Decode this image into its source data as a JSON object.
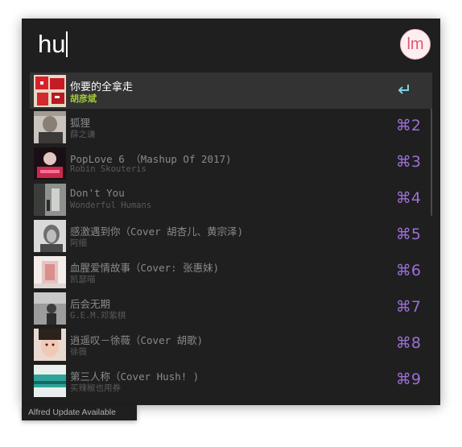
{
  "search": {
    "query": "hu"
  },
  "avatar": {
    "initials": "lm",
    "color": "#e0576f"
  },
  "accent_color": "#9b6fd6",
  "selected_subtitle_color": "#a3c93a",
  "results": [
    {
      "title": "你要的全拿走",
      "subtitle": "胡彦斌",
      "shortcut": "",
      "selected": true,
      "action_icon": "return-icon"
    },
    {
      "title": "狐狸",
      "subtitle": "薛之谦",
      "shortcut": "⌘2"
    },
    {
      "title": "PopLove 6 （Mashup Of 2017)",
      "subtitle": "Robin Skouteris",
      "shortcut": "⌘3"
    },
    {
      "title": "Don't You",
      "subtitle": "Wonderful Humans",
      "shortcut": "⌘4"
    },
    {
      "title": "感激遇到你（Cover 胡杏儿、黄宗泽)",
      "subtitle": "阿细",
      "shortcut": "⌘5"
    },
    {
      "title": "血腥爱情故事（Cover: 张惠妹)",
      "subtitle": "凯瑟喵",
      "shortcut": "⌘6"
    },
    {
      "title": "后会无期",
      "subtitle": "G.E.M.邓紫棋",
      "shortcut": "⌘7"
    },
    {
      "title": "逍遥叹－徐薇（Cover 胡歌)",
      "subtitle": "徐薇",
      "shortcut": "⌘8"
    },
    {
      "title": "第三人称（Cover Hush! )",
      "subtitle": "买辣椒也用券",
      "shortcut": "⌘9"
    }
  ],
  "footer": {
    "update_label": "Alfred Update Available"
  }
}
